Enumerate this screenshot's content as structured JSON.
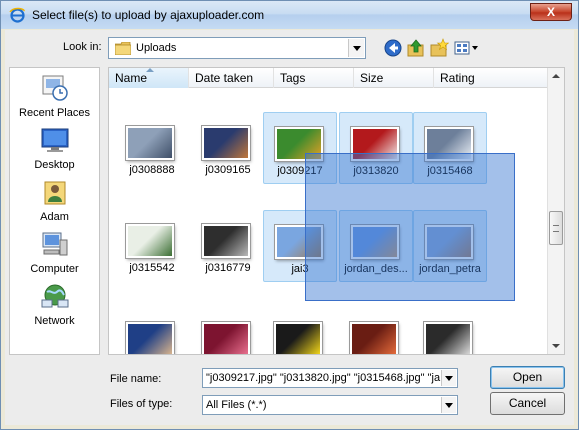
{
  "window": {
    "title": "Select file(s) to upload by ajaxuploader.com",
    "close_label": "X"
  },
  "toolbar": {
    "look_in_label": "Look in:",
    "look_in_value": "Uploads",
    "buttons": [
      "back-icon",
      "up-folder-icon",
      "new-folder-icon",
      "views-menu-icon"
    ]
  },
  "places": [
    {
      "label": "Recent Places",
      "icon": "recent-places-icon"
    },
    {
      "label": "Desktop",
      "icon": "desktop-icon"
    },
    {
      "label": "Adam",
      "icon": "user-folder-icon"
    },
    {
      "label": "Computer",
      "icon": "computer-icon"
    },
    {
      "label": "Network",
      "icon": "network-icon"
    }
  ],
  "columns": [
    "Name",
    "Date taken",
    "Tags",
    "Size",
    "Rating"
  ],
  "sort_column": "Name",
  "files": [
    {
      "name": "j0308888",
      "selected": false,
      "colors": [
        "#8ea0b8",
        "#3f4f68"
      ]
    },
    {
      "name": "j0309165",
      "selected": false,
      "colors": [
        "#2a3b6e",
        "#c0773a"
      ]
    },
    {
      "name": "j0309217",
      "selected": true,
      "colors": [
        "#3b8b2e",
        "#e3a126"
      ]
    },
    {
      "name": "j0313820",
      "selected": true,
      "colors": [
        "#b3191c",
        "#f1e8e6"
      ]
    },
    {
      "name": "j0315468",
      "selected": true,
      "colors": [
        "#6d7f9a",
        "#e8eef5"
      ]
    },
    {
      "name": "j0315542",
      "selected": false,
      "colors": [
        "#e9efe6",
        "#3b6e33"
      ]
    },
    {
      "name": "j0316779",
      "selected": false,
      "colors": [
        "#2e2e2e",
        "#b9b9b9"
      ]
    },
    {
      "name": "jai3",
      "selected": true,
      "colors": [
        "#7aa6e0",
        "#a07b54"
      ]
    },
    {
      "name": "jordan_des...",
      "selected": true,
      "colors": [
        "#6d9ae0",
        "#c79a6a"
      ]
    },
    {
      "name": "jordan_petra",
      "selected": true,
      "colors": [
        "#8aa7d4",
        "#a57c61"
      ]
    },
    {
      "name": "",
      "selected": false,
      "colors": [
        "#1f3f86",
        "#d7b38d"
      ]
    },
    {
      "name": "",
      "selected": false,
      "colors": [
        "#7d1430",
        "#e86f8e"
      ]
    },
    {
      "name": "",
      "selected": false,
      "colors": [
        "#1a1a1a",
        "#f1d51a"
      ]
    },
    {
      "name": "",
      "selected": false,
      "colors": [
        "#6a1d13",
        "#e36a3a"
      ]
    },
    {
      "name": "",
      "selected": false,
      "colors": [
        "#2b2b2b",
        "#d9d9d9"
      ]
    }
  ],
  "fields": {
    "file_name_label": "File name:",
    "file_name_value": "\"j0309217.jpg\" \"j0313820.jpg\" \"j0315468.jpg\" \"ja",
    "file_type_label": "Files of type:",
    "file_type_value": "All Files (*.*)"
  },
  "buttons": {
    "open": "Open",
    "cancel": "Cancel"
  },
  "colors": {
    "selection": "#b4d7f5",
    "marquee": "#3474d0"
  }
}
